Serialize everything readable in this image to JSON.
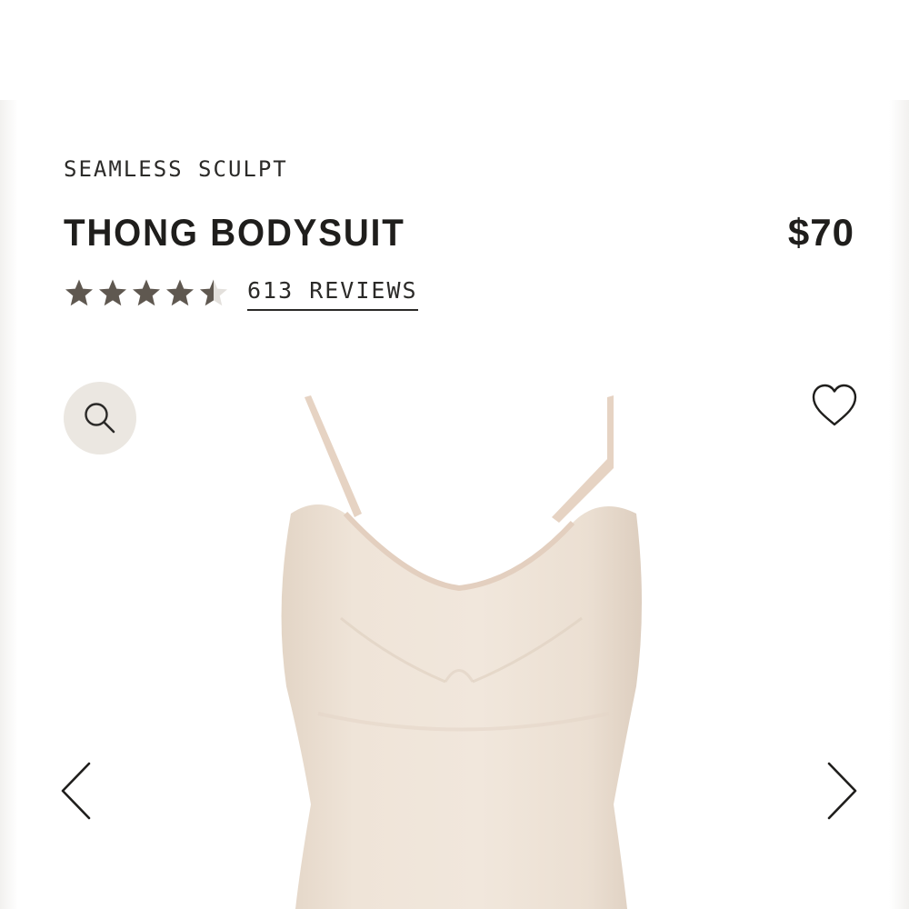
{
  "product": {
    "collection": "SEAMLESS SCULPT",
    "name": "THONG BODYSUIT",
    "price": "$70",
    "rating": 4.5,
    "rating_max": 5,
    "reviews_label": "613 REVIEWS",
    "star_color": "#5f5850"
  },
  "icons": {
    "zoom": "search-icon",
    "wishlist": "heart-icon",
    "previous": "chevron-left-icon",
    "next": "chevron-right-icon"
  },
  "colors": {
    "zoom_button_bg": "#ebe7e1",
    "product_color": "#ece0d3"
  }
}
